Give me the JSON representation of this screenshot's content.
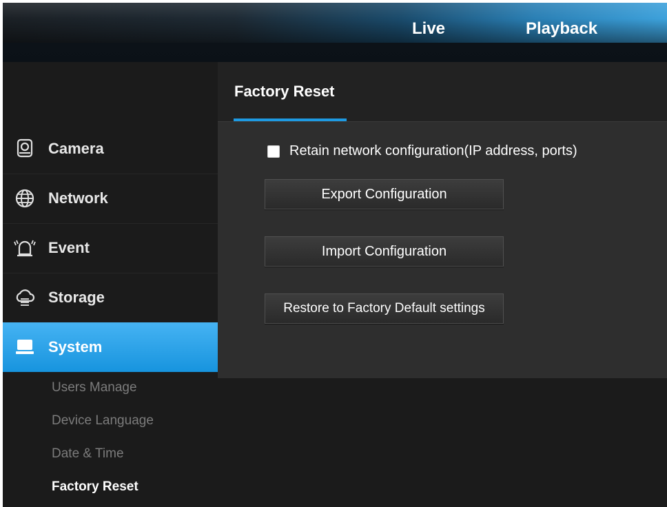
{
  "header": {
    "nav": {
      "live": "Live",
      "playback": "Playback"
    }
  },
  "sidebar": {
    "items": [
      {
        "label": "Camera",
        "icon": "camera-icon"
      },
      {
        "label": "Network",
        "icon": "globe-icon"
      },
      {
        "label": "Event",
        "icon": "alarm-icon"
      },
      {
        "label": "Storage",
        "icon": "cloud-storage-icon"
      },
      {
        "label": "System",
        "icon": "monitor-icon",
        "active": true
      }
    ],
    "subitems": [
      "Users Manage",
      "Device Language",
      "Date & Time",
      "Factory Reset"
    ],
    "current_subitem": "Factory Reset"
  },
  "main": {
    "title": "Factory Reset",
    "retain_label": "Retain network configuration(IP address, ports)",
    "retain_checked": false,
    "buttons": {
      "export": "Export Configuration",
      "import": "Import Configuration",
      "restore": "Restore to Factory Default settings"
    }
  },
  "colors": {
    "accent": "#1e9ae2",
    "sidebar_bg": "#1b1b1b",
    "panel_bg": "#2e2e2e"
  }
}
